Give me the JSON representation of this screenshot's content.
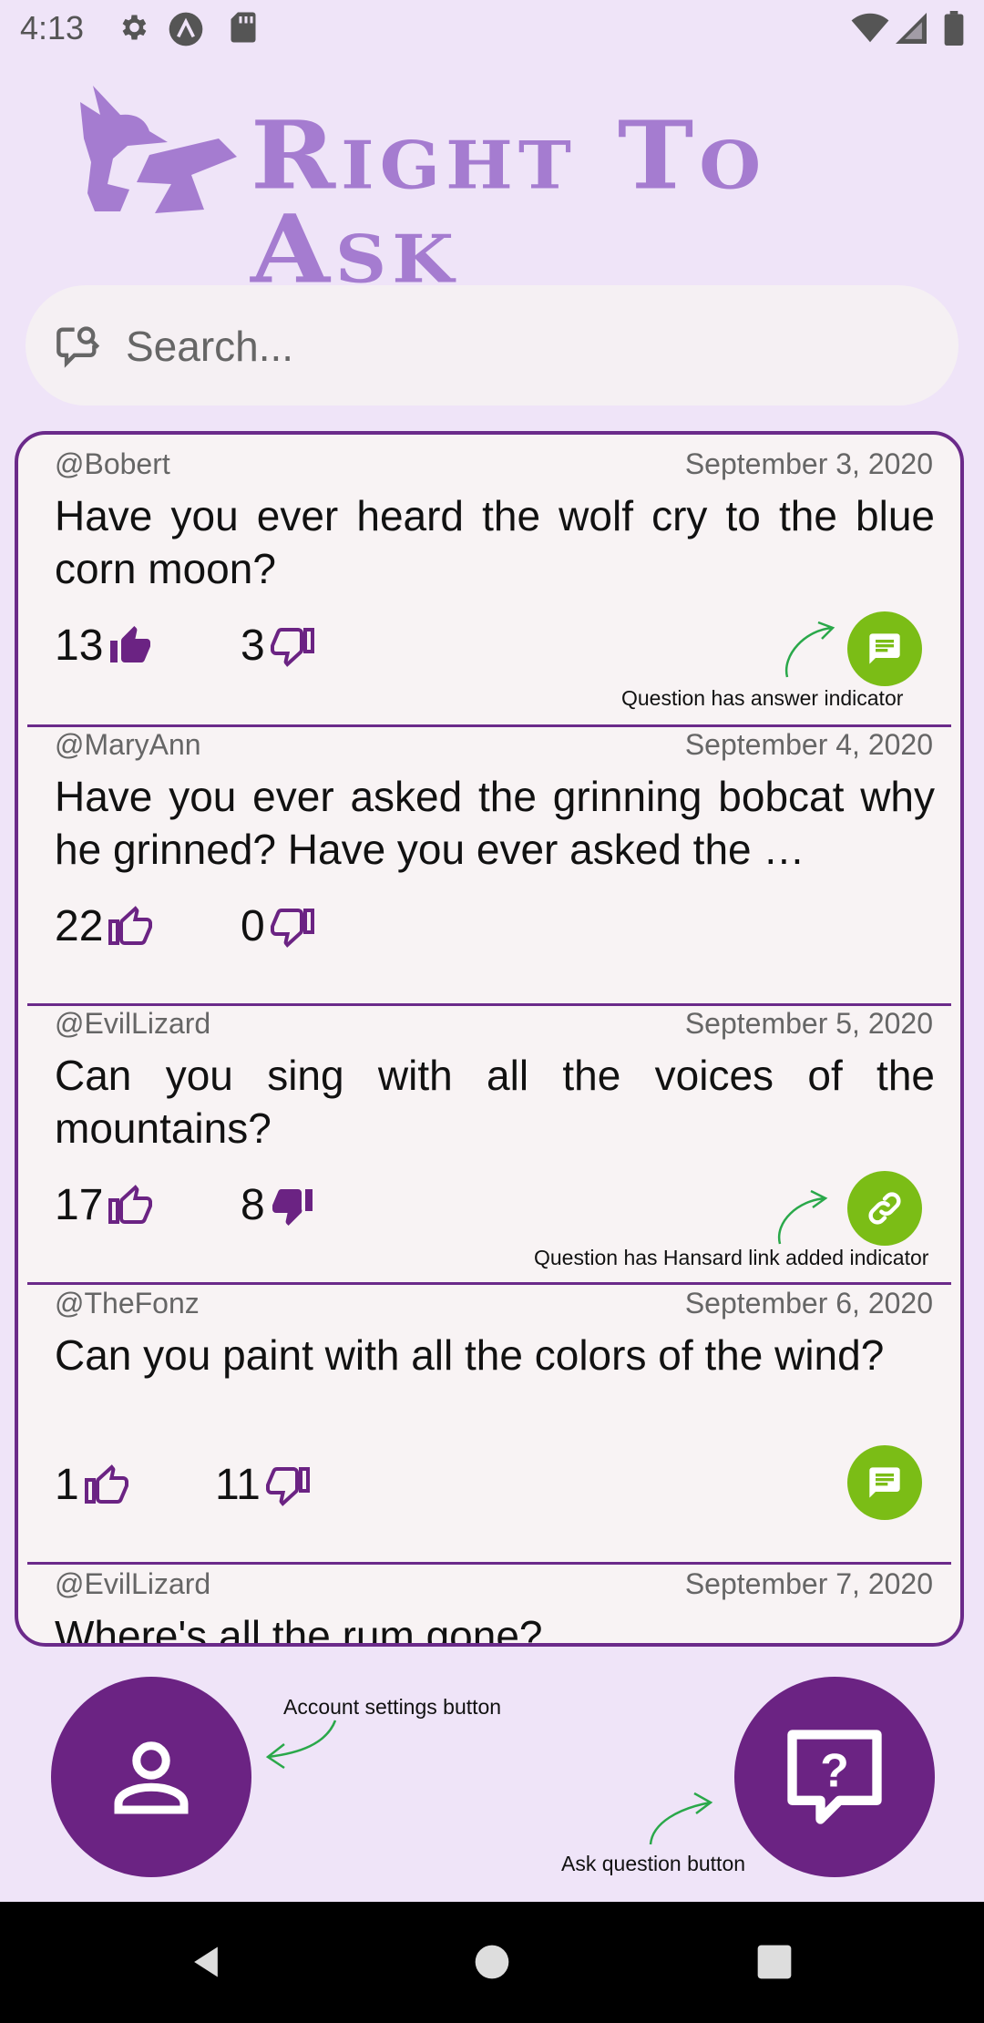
{
  "status_bar": {
    "time": "4:13",
    "icons": [
      "settings-icon",
      "a-circle-icon",
      "sd-card-icon",
      "wifi-icon",
      "signal-icon",
      "battery-icon"
    ]
  },
  "app": {
    "title": "Right To Ask",
    "accent": "#6b2383",
    "logo_color": "#a57cd0"
  },
  "search": {
    "placeholder": "Search...",
    "value": ""
  },
  "questions": [
    {
      "user": "@Bobert",
      "date": "September 3, 2020",
      "text": "Have you ever heard the wolf cry to the blue corn moon?",
      "upvotes": "13",
      "downvotes": "3",
      "upvoted": true,
      "downvoted": false,
      "indicator": "answer"
    },
    {
      "user": "@MaryAnn",
      "date": "September 4, 2020",
      "text": "Have you ever asked the grinning bobcat why he grinned? Have you ever asked the …",
      "upvotes": "22",
      "downvotes": "0",
      "upvoted": false,
      "downvoted": false,
      "indicator": ""
    },
    {
      "user": "@EvilLizard",
      "date": "September 5, 2020",
      "text": "Can you sing with all the voices of the mountains?",
      "upvotes": "17",
      "downvotes": "8",
      "upvoted": false,
      "downvoted": true,
      "indicator": "link"
    },
    {
      "user": "@TheFonz",
      "date": "September 6, 2020",
      "text": "Can you paint with all the colors of the wind?",
      "upvotes": "1",
      "downvotes": "11",
      "upvoted": false,
      "downvoted": false,
      "indicator": "answer"
    },
    {
      "user": "@EvilLizard",
      "date": "September 7, 2020",
      "text": "Where's all the rum gone?",
      "upvotes": "",
      "downvotes": "",
      "upvoted": false,
      "downvoted": false,
      "indicator": ""
    }
  ],
  "annotations": {
    "answer_indicator": "Question has answer indicator",
    "hansard_indicator": "Question has Hansard link added indicator",
    "account_button": "Account settings button",
    "ask_button": "Ask question button"
  },
  "colors": {
    "indicator_green": "#7bbd16",
    "annotation_arrow": "#2aa84a",
    "border": "#6b2a8a"
  }
}
